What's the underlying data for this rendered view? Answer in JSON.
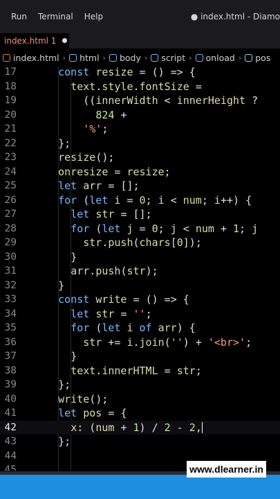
{
  "menubar": {
    "items": [
      "Run",
      "Terminal",
      "Help"
    ],
    "window_title": "● index.html - Diamo"
  },
  "tab": {
    "label": "index.html 1"
  },
  "breadcrumb": [
    "index.html",
    "html",
    "body",
    "script",
    "onload",
    "pos"
  ],
  "editor": {
    "lines": [
      {
        "n": "17",
        "text": "    const resize = () => {"
      },
      {
        "n": "18",
        "text": "      text.style.fontSize ="
      },
      {
        "n": "19",
        "text": "        ((innerWidth < innerHeight ?"
      },
      {
        "n": "20",
        "text": "          824 +"
      },
      {
        "n": "21",
        "text": "        '%';"
      },
      {
        "n": "22",
        "text": "    };"
      },
      {
        "n": "23",
        "text": "    resize();"
      },
      {
        "n": "24",
        "text": "    onresize = resize;"
      },
      {
        "n": "25",
        "text": "    let arr = [];"
      },
      {
        "n": "26",
        "text": "    for (let i = 0; i < num; i++) {"
      },
      {
        "n": "27",
        "text": "      let str = [];"
      },
      {
        "n": "28",
        "text": "      for (let j = 0; j < num + 1; j"
      },
      {
        "n": "29",
        "text": "        str.push(chars[0]);"
      },
      {
        "n": "30",
        "text": "      }"
      },
      {
        "n": "31",
        "text": "      arr.push(str);"
      },
      {
        "n": "32",
        "text": "    }"
      },
      {
        "n": "33",
        "text": "    const write = () => {"
      },
      {
        "n": "34",
        "text": "      let str = '';"
      },
      {
        "n": "35",
        "text": "      for (let i of arr) {"
      },
      {
        "n": "36",
        "text": "        str += i.join('') + '<br>';"
      },
      {
        "n": "37",
        "text": "      }"
      },
      {
        "n": "38",
        "text": "      text.innerHTML = str;"
      },
      {
        "n": "39",
        "text": "    };"
      },
      {
        "n": "40",
        "text": "    write();"
      },
      {
        "n": "41",
        "text": "    let pos = {"
      },
      {
        "n": "42",
        "text": "      x: (num + 1) / 2 - 2,"
      },
      {
        "n": "43",
        "text": "    };"
      },
      {
        "n": "44",
        "text": ""
      },
      {
        "n": "45",
        "text": ""
      }
    ],
    "active_line": "42"
  },
  "watermark": "www.dlearner.in",
  "colors": {
    "keyword": "#7fb6ff",
    "identifier": "#dcdcaa",
    "string": "#ff9d82",
    "number": "#c5e6a6",
    "statusbar": "#1e8fe0",
    "tab_label": "#ff8c7a"
  }
}
